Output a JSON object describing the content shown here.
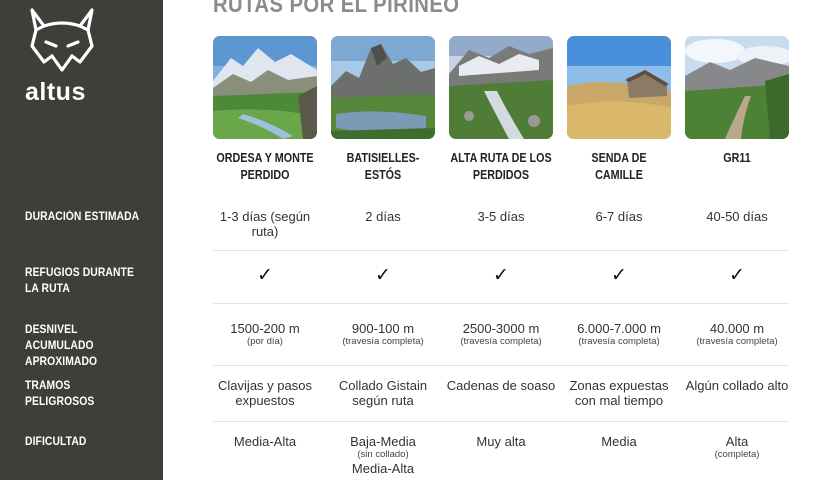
{
  "brand": {
    "name": "altus",
    "logo_icon": "lynx-head-icon"
  },
  "title": "RUTAS POR EL PIRINEO",
  "row_labels": {
    "duration": "DURACIÓN ESTIMADA",
    "refuges": "REFUGIOS DURANTE LA RUTA",
    "elevation": "DESNIVEL ACUMULADO APROXIMADO",
    "dangerous": "TRAMOS PELIGROSOS",
    "difficulty": "DIFICULTAD"
  },
  "routes": [
    {
      "name": "ORDESA Y MONTE PERDIDO",
      "duration": "1-3 días (según ruta)",
      "refuges": "✓",
      "elevation": "1500-200 m",
      "elevation_note": "(por día)",
      "dangerous": "Clavijas y pasos expuestos",
      "difficulty": "Media-Alta",
      "difficulty_note": "",
      "difficulty_extra": ""
    },
    {
      "name": "BATISIELLES-ESTÓS",
      "duration": "2 días",
      "refuges": "✓",
      "elevation": "900-100 m",
      "elevation_note": "(travesía completa)",
      "dangerous": "Collado Gistain según ruta",
      "difficulty": "Baja-Media",
      "difficulty_note": "(sin collado)",
      "difficulty_extra": "Media-Alta"
    },
    {
      "name": "ALTA RUTA DE LOS PERDIDOS",
      "duration": "3-5 días",
      "refuges": "✓",
      "elevation": "2500-3000 m",
      "elevation_note": "(travesía completa)",
      "dangerous": "Cadenas de soaso",
      "difficulty": "Muy alta",
      "difficulty_note": "",
      "difficulty_extra": ""
    },
    {
      "name": "SENDA DE CAMILLE",
      "duration": "6-7 días",
      "refuges": "✓",
      "elevation": "6.000-7.000 m",
      "elevation_note": "(travesía completa)",
      "dangerous": "Zonas expuestas con mal tiempo",
      "difficulty": "Media",
      "difficulty_note": "",
      "difficulty_extra": ""
    },
    {
      "name": "GR11",
      "duration": "40-50 días",
      "refuges": "✓",
      "elevation": "40.000 m",
      "elevation_note": "(travesía completa)",
      "dangerous": "Algún collado alto",
      "difficulty": "Alta",
      "difficulty_note": "(completa)",
      "difficulty_extra": ""
    }
  ]
}
